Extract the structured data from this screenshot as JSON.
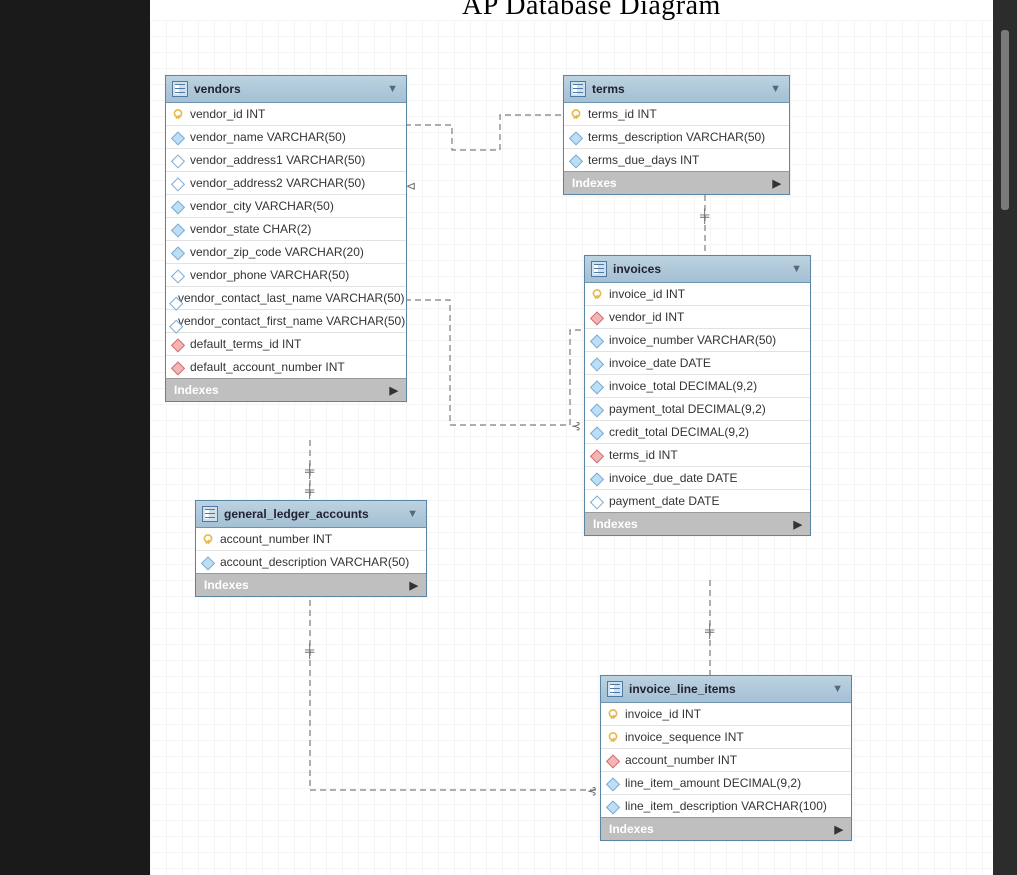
{
  "title_fragment": "AP Database Diagram",
  "indexes_label": "Indexes",
  "entities": {
    "vendors": {
      "name": "vendors",
      "columns": [
        {
          "icon": "key",
          "text": "vendor_id INT"
        },
        {
          "icon": "dia",
          "text": "vendor_name VARCHAR(50)"
        },
        {
          "icon": "dia-hollow",
          "text": "vendor_address1 VARCHAR(50)"
        },
        {
          "icon": "dia-hollow",
          "text": "vendor_address2 VARCHAR(50)"
        },
        {
          "icon": "dia",
          "text": "vendor_city VARCHAR(50)"
        },
        {
          "icon": "dia",
          "text": "vendor_state CHAR(2)"
        },
        {
          "icon": "dia",
          "text": "vendor_zip_code VARCHAR(20)"
        },
        {
          "icon": "dia-hollow",
          "text": "vendor_phone VARCHAR(50)"
        },
        {
          "icon": "dia-hollow",
          "text": "vendor_contact_last_name VARCHAR(50)"
        },
        {
          "icon": "dia-hollow",
          "text": "vendor_contact_first_name VARCHAR(50)"
        },
        {
          "icon": "dia-red",
          "text": "default_terms_id INT"
        },
        {
          "icon": "dia-red",
          "text": "default_account_number INT"
        }
      ]
    },
    "terms": {
      "name": "terms",
      "columns": [
        {
          "icon": "key",
          "text": "terms_id INT"
        },
        {
          "icon": "dia",
          "text": "terms_description VARCHAR(50)"
        },
        {
          "icon": "dia",
          "text": "terms_due_days INT"
        }
      ]
    },
    "general_ledger": {
      "name": "general_ledger_accounts",
      "columns": [
        {
          "icon": "key",
          "text": "account_number INT"
        },
        {
          "icon": "dia",
          "text": "account_description VARCHAR(50)"
        }
      ]
    },
    "invoices": {
      "name": "invoices",
      "columns": [
        {
          "icon": "key",
          "text": "invoice_id INT"
        },
        {
          "icon": "dia-red",
          "text": "vendor_id INT"
        },
        {
          "icon": "dia",
          "text": "invoice_number VARCHAR(50)"
        },
        {
          "icon": "dia",
          "text": "invoice_date DATE"
        },
        {
          "icon": "dia",
          "text": "invoice_total DECIMAL(9,2)"
        },
        {
          "icon": "dia",
          "text": "payment_total DECIMAL(9,2)"
        },
        {
          "icon": "dia",
          "text": "credit_total DECIMAL(9,2)"
        },
        {
          "icon": "dia-red",
          "text": "terms_id INT"
        },
        {
          "icon": "dia",
          "text": "invoice_due_date DATE"
        },
        {
          "icon": "dia-hollow",
          "text": "payment_date DATE"
        }
      ]
    },
    "invoice_line_items": {
      "name": "invoice_line_items",
      "columns": [
        {
          "icon": "key",
          "text": "invoice_id INT"
        },
        {
          "icon": "key",
          "text": "invoice_sequence INT"
        },
        {
          "icon": "dia-red",
          "text": "account_number INT"
        },
        {
          "icon": "dia",
          "text": "line_item_amount DECIMAL(9,2)"
        },
        {
          "icon": "dia",
          "text": "line_item_description VARCHAR(100)"
        }
      ]
    }
  },
  "relationships": [
    {
      "from": "vendors.default_terms_id",
      "to": "terms.terms_id"
    },
    {
      "from": "vendors.vendor_id",
      "to": "invoices.vendor_id"
    },
    {
      "from": "vendors.default_account_number",
      "to": "general_ledger_accounts.account_number"
    },
    {
      "from": "terms.terms_id",
      "to": "invoices.terms_id"
    },
    {
      "from": "invoices.invoice_id",
      "to": "invoice_line_items.invoice_id"
    },
    {
      "from": "general_ledger_accounts.account_number",
      "to": "invoice_line_items.account_number"
    }
  ]
}
